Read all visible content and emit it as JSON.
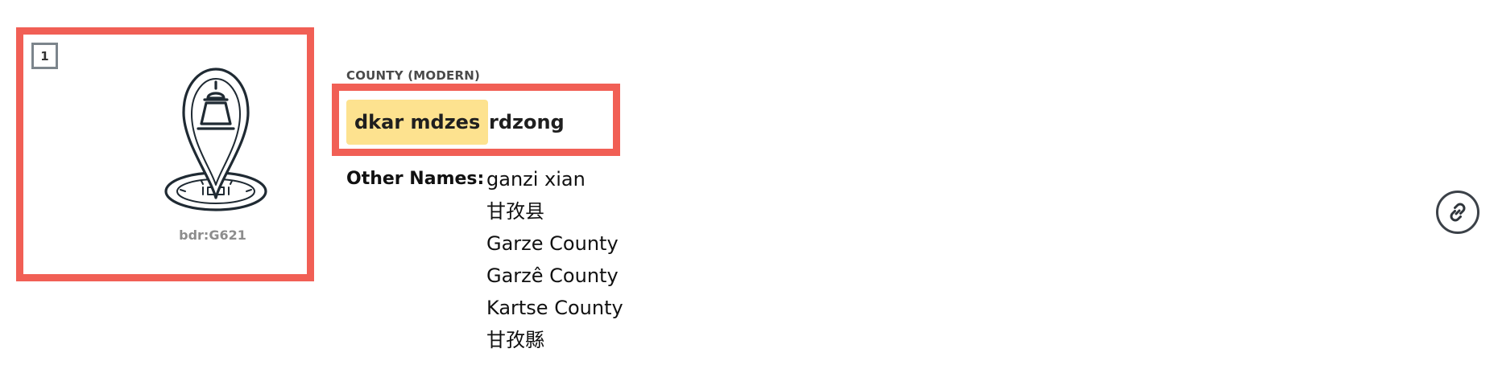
{
  "result": {
    "index": "1",
    "resource_id": "bdr:G621",
    "type_label": "COUNTY (MODERN)",
    "title_highlight": "dkar mdzes",
    "title_rest": "rdzong",
    "other_names_label": "Other Names:",
    "other_names": [
      "ganzi xian",
      "甘孜县",
      "Garze County",
      "Garzê County",
      "Kartse County",
      "甘孜縣"
    ]
  },
  "icons": {
    "thumbnail": "place-pin-icon",
    "permalink": "link-icon"
  },
  "colors": {
    "selection_outline": "#f15f55",
    "highlight": "#fde28f",
    "icon_stroke": "#1f2a33"
  }
}
